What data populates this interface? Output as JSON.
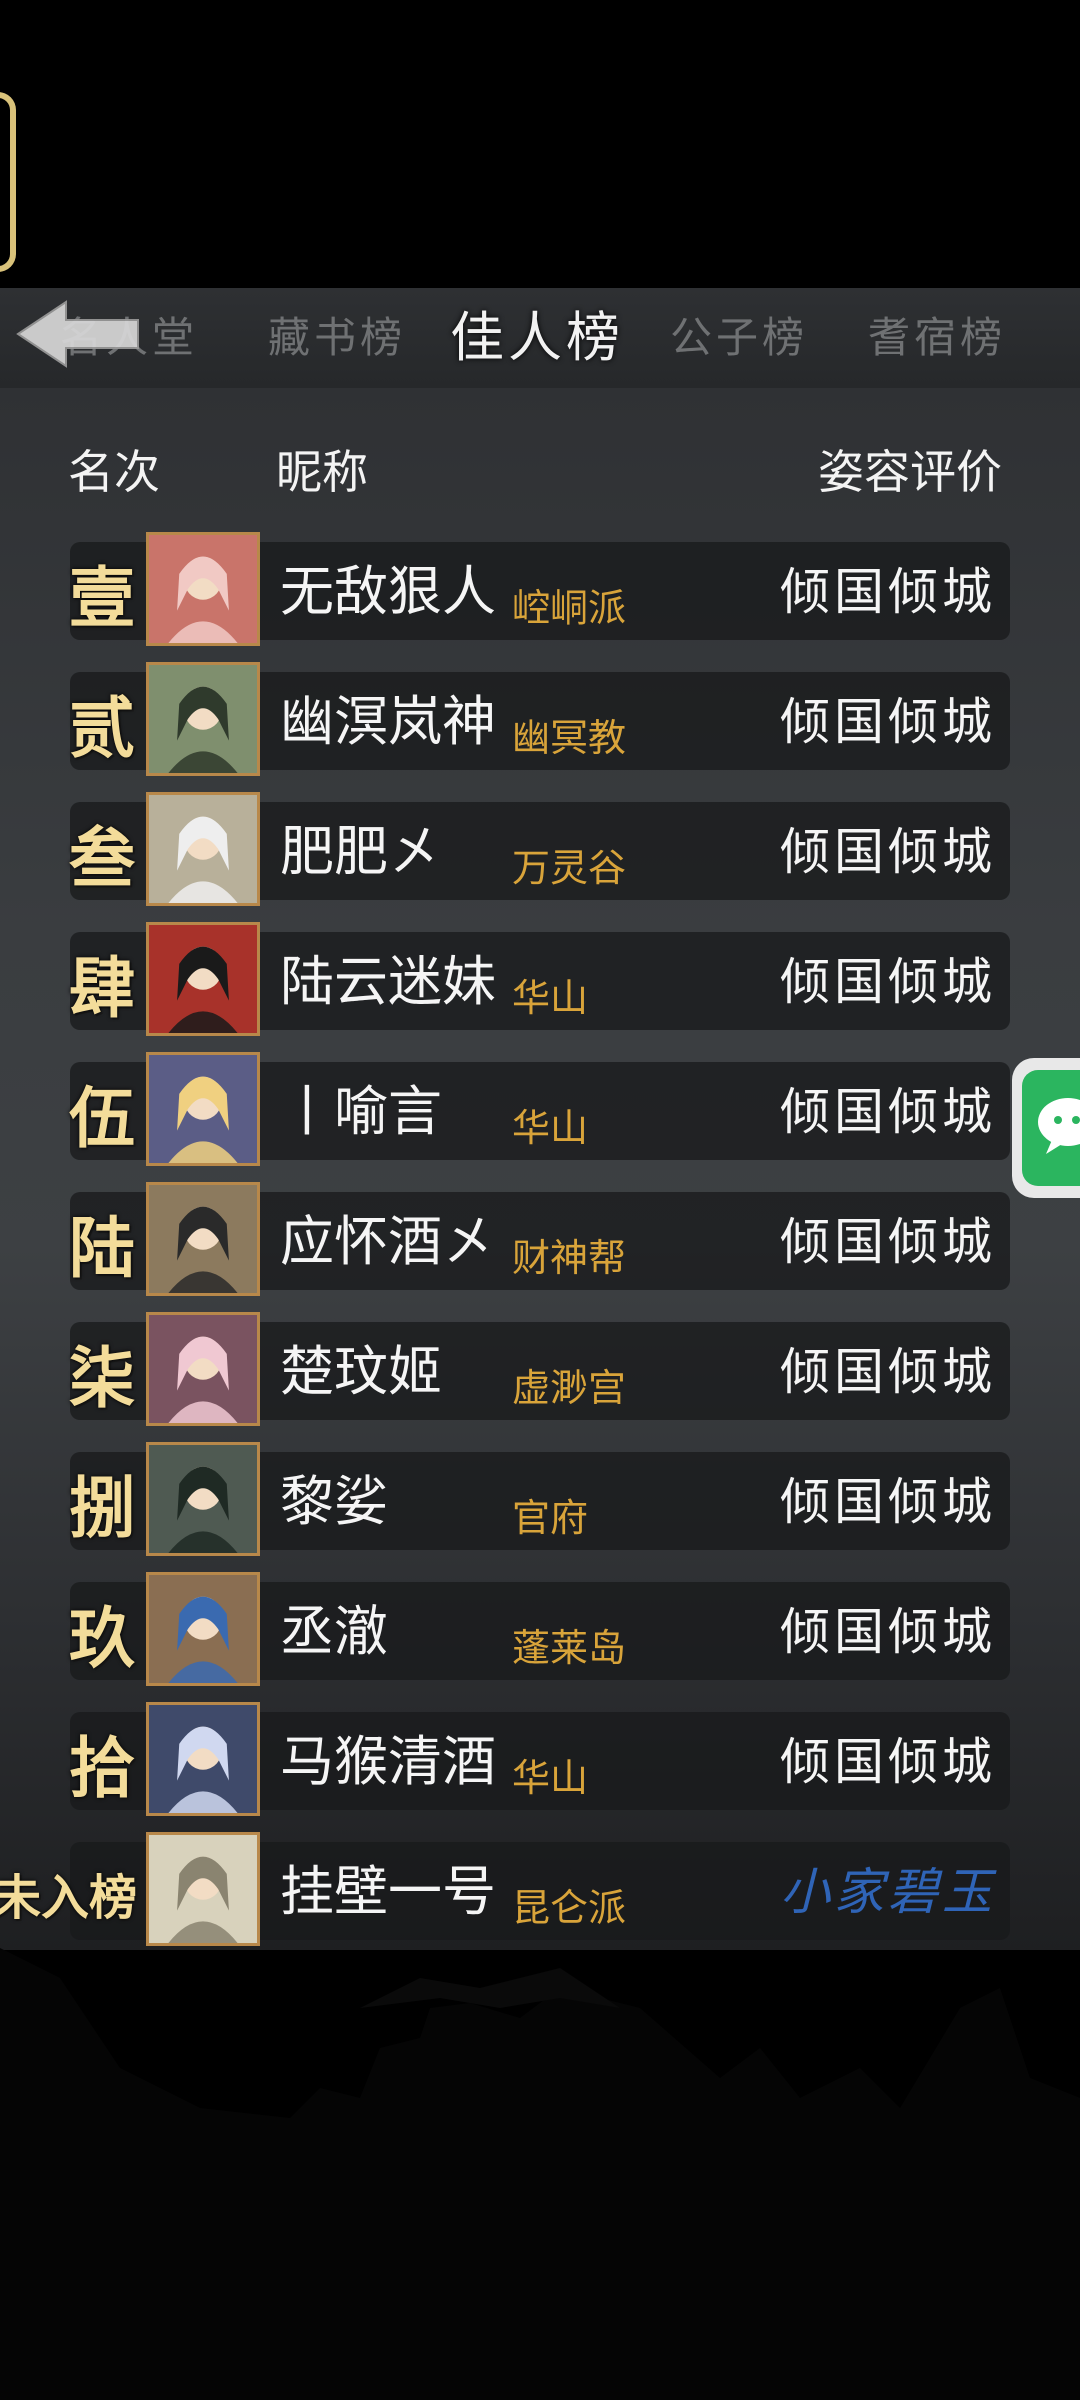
{
  "tabs": [
    {
      "label": "名人堂"
    },
    {
      "label": "藏书榜"
    },
    {
      "label": "佳人榜"
    },
    {
      "label": "公子榜"
    },
    {
      "label": "耆宿榜"
    }
  ],
  "header": {
    "rank_col": "名次",
    "nick_col": "昵称",
    "rating_col": "姿容评价"
  },
  "rows": [
    {
      "rank": "壹",
      "nick": "无敌狠人",
      "sect": "崆峒派",
      "rating": "倾国倾城",
      "avatar": "bunny-avatar"
    },
    {
      "rank": "贰",
      "nick": "幽溟岚神",
      "sect": "幽冥教",
      "rating": "倾国倾城",
      "avatar": "maiden-green-avatar"
    },
    {
      "rank": "叁",
      "nick": "肥肥㐅",
      "sect": "万灵谷",
      "rating": "倾国倾城",
      "avatar": "white-hair-avatar"
    },
    {
      "rank": "肆",
      "nick": "陆云迷妹",
      "sect": "华山",
      "rating": "倾国倾城",
      "avatar": "red-fortune-avatar"
    },
    {
      "rank": "伍",
      "nick": "丨喻言",
      "sect": "华山",
      "rating": "倾国倾城",
      "avatar": "moon-lady-avatar"
    },
    {
      "rank": "陆",
      "nick": "应怀酒㐅",
      "sect": "财神帮",
      "rating": "倾国倾城",
      "avatar": "swordswoman-avatar"
    },
    {
      "rank": "柒",
      "nick": "楚玟姬",
      "sect": "虚渺宫",
      "rating": "倾国倾城",
      "avatar": "plum-lady-avatar"
    },
    {
      "rank": "捌",
      "nick": "黎娑",
      "sect": "官府",
      "rating": "倾国倾城",
      "avatar": "dark-robe-avatar"
    },
    {
      "rank": "玖",
      "nick": "丞澈",
      "sect": "蓬莱岛",
      "rating": "倾国倾城",
      "avatar": "blue-hair-avatar"
    },
    {
      "rank": "拾",
      "nick": "马猴清酒",
      "sect": "华山",
      "rating": "倾国倾城",
      "avatar": "dancer-avatar"
    },
    {
      "rank": "未入榜",
      "nick": "挂壁一号",
      "sect": "昆仑派",
      "rating": "小家碧玉",
      "avatar": "sketch-avatar"
    }
  ],
  "colors": {
    "rank_gold": "#f3dc9a",
    "sect_orange": "#d9a43a",
    "rating_blue": "#2f64b7",
    "wechat_green": "#2bb55f"
  }
}
